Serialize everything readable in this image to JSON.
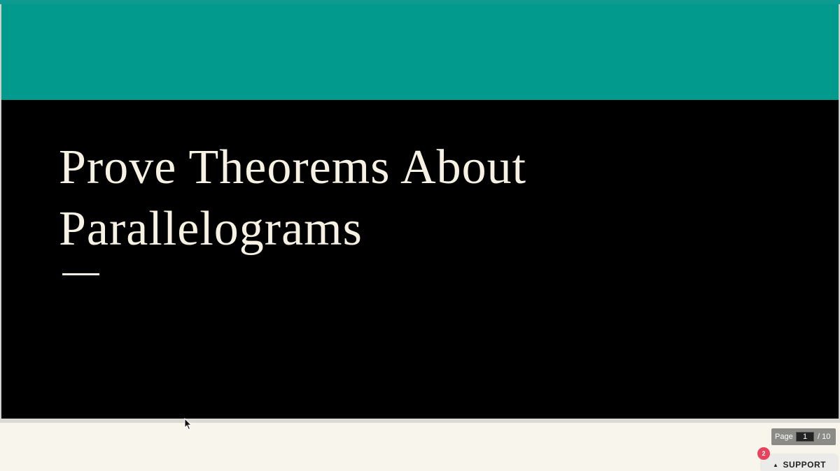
{
  "slide": {
    "title_line1": "Prove Theorems About",
    "title_line2": "Parallelograms",
    "band_color": "#019a8d",
    "background_color": "#000000",
    "text_color": "#f6f1e3"
  },
  "pager": {
    "label": "Page",
    "current_page": "1",
    "total": "/ 10"
  },
  "support": {
    "badge_count": "2",
    "label": "SUPPORT",
    "caret_icon": "caret-up-icon",
    "badge_color": "#e8435d"
  },
  "cursor": {
    "icon": "mouse-pointer-icon"
  }
}
